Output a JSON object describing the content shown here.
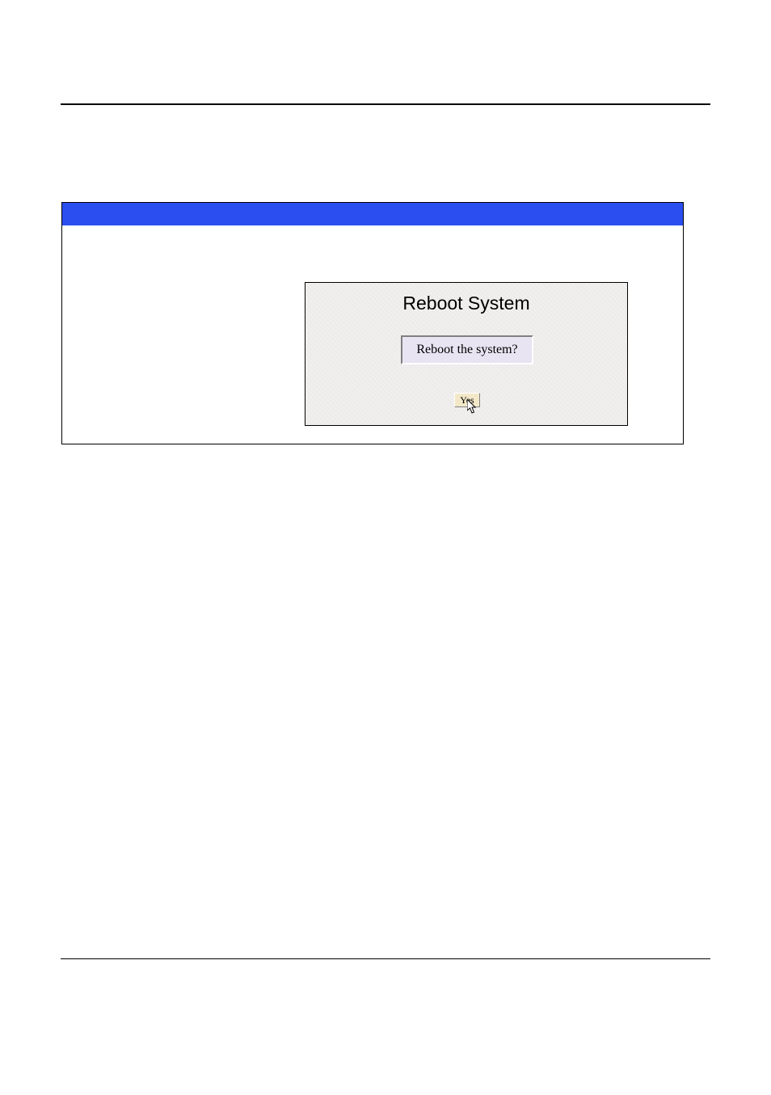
{
  "dialog": {
    "title": "Reboot System",
    "question": "Reboot the system?",
    "confirm_label": "Yes"
  }
}
